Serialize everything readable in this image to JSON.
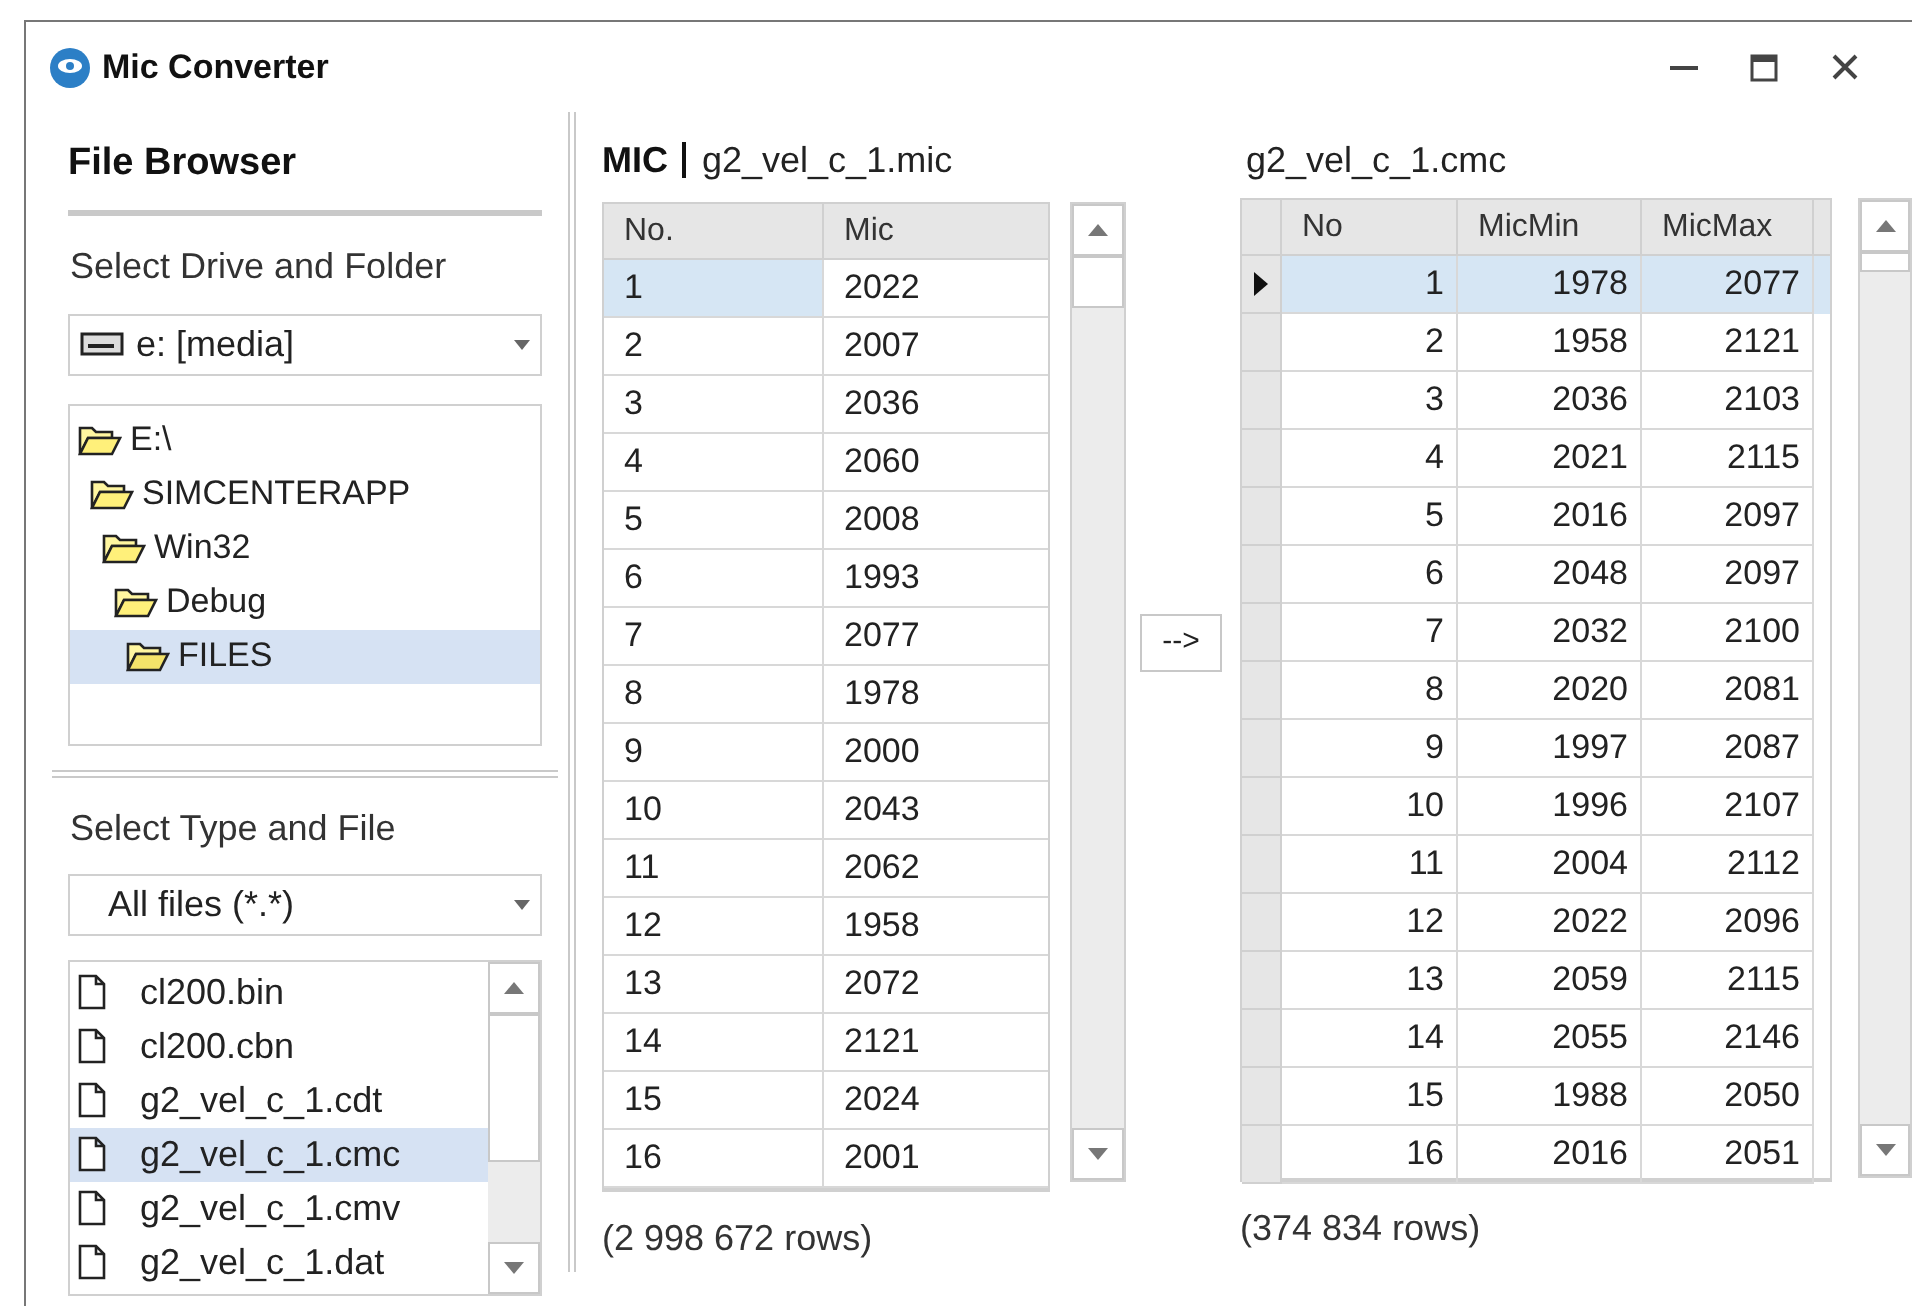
{
  "window": {
    "title": "Mic Converter"
  },
  "file_browser": {
    "title": "File Browser",
    "drive_label": "Select Drive and Folder",
    "drive": "e: [media]",
    "folders": [
      {
        "label": "E:\\",
        "selected": false,
        "children": [
          {
            "label": "SIMCENTERAPP",
            "selected": false,
            "children": [
              {
                "label": "Win32",
                "selected": false,
                "children": [
                  {
                    "label": "Debug",
                    "selected": false,
                    "children": [
                      {
                        "label": "FILES",
                        "selected": true
                      }
                    ]
                  }
                ]
              }
            ]
          }
        ]
      }
    ],
    "type_label": "Select Type and File",
    "type_filter": "All files (*.*)",
    "files": [
      {
        "name": "cl200.bin",
        "selected": false
      },
      {
        "name": "cl200.cbn",
        "selected": false
      },
      {
        "name": "g2_vel_c_1.cdt",
        "selected": false
      },
      {
        "name": "g2_vel_c_1.cmc",
        "selected": true
      },
      {
        "name": "g2_vel_c_1.cmv",
        "selected": false
      },
      {
        "name": "g2_vel_c_1.dat",
        "selected": false
      }
    ]
  },
  "mic_table": {
    "prefix": "MIC",
    "file": "g2_vel_c_1.mic",
    "columns": [
      "No.",
      "Mic"
    ],
    "rows": [
      {
        "cells": [
          "1",
          "2022"
        ],
        "selected": true
      },
      {
        "cells": [
          "2",
          "2007"
        ],
        "selected": false
      },
      {
        "cells": [
          "3",
          "2036"
        ],
        "selected": false
      },
      {
        "cells": [
          "4",
          "2060"
        ],
        "selected": false
      },
      {
        "cells": [
          "5",
          "2008"
        ],
        "selected": false
      },
      {
        "cells": [
          "6",
          "1993"
        ],
        "selected": false
      },
      {
        "cells": [
          "7",
          "2077"
        ],
        "selected": false
      },
      {
        "cells": [
          "8",
          "1978"
        ],
        "selected": false
      },
      {
        "cells": [
          "9",
          "2000"
        ],
        "selected": false
      },
      {
        "cells": [
          "10",
          "2043"
        ],
        "selected": false
      },
      {
        "cells": [
          "11",
          "2062"
        ],
        "selected": false
      },
      {
        "cells": [
          "12",
          "1958"
        ],
        "selected": false
      },
      {
        "cells": [
          "13",
          "2072"
        ],
        "selected": false
      },
      {
        "cells": [
          "14",
          "2121"
        ],
        "selected": false
      },
      {
        "cells": [
          "15",
          "2024"
        ],
        "selected": false
      },
      {
        "cells": [
          "16",
          "2001"
        ],
        "selected": false
      }
    ],
    "row_count": "(2 998 672 rows)"
  },
  "convert_button": "-->",
  "cmc_table": {
    "file": "g2_vel_c_1.cmc",
    "columns": [
      "No",
      "MicMin",
      "MicMax"
    ],
    "rows": [
      {
        "cells": [
          "1",
          "1978",
          "2077"
        ],
        "selected": true
      },
      {
        "cells": [
          "2",
          "1958",
          "2121"
        ],
        "selected": false
      },
      {
        "cells": [
          "3",
          "2036",
          "2103"
        ],
        "selected": false
      },
      {
        "cells": [
          "4",
          "2021",
          "2115"
        ],
        "selected": false
      },
      {
        "cells": [
          "5",
          "2016",
          "2097"
        ],
        "selected": false
      },
      {
        "cells": [
          "6",
          "2048",
          "2097"
        ],
        "selected": false
      },
      {
        "cells": [
          "7",
          "2032",
          "2100"
        ],
        "selected": false
      },
      {
        "cells": [
          "8",
          "2020",
          "2081"
        ],
        "selected": false
      },
      {
        "cells": [
          "9",
          "1997",
          "2087"
        ],
        "selected": false
      },
      {
        "cells": [
          "10",
          "1996",
          "2107"
        ],
        "selected": false
      },
      {
        "cells": [
          "11",
          "2004",
          "2112"
        ],
        "selected": false
      },
      {
        "cells": [
          "12",
          "2022",
          "2096"
        ],
        "selected": false
      },
      {
        "cells": [
          "13",
          "2059",
          "2115"
        ],
        "selected": false
      },
      {
        "cells": [
          "14",
          "2055",
          "2146"
        ],
        "selected": false
      },
      {
        "cells": [
          "15",
          "1988",
          "2050"
        ],
        "selected": false
      },
      {
        "cells": [
          "16",
          "2016",
          "2051"
        ],
        "selected": false
      }
    ],
    "row_count": "(374 834 rows)"
  }
}
